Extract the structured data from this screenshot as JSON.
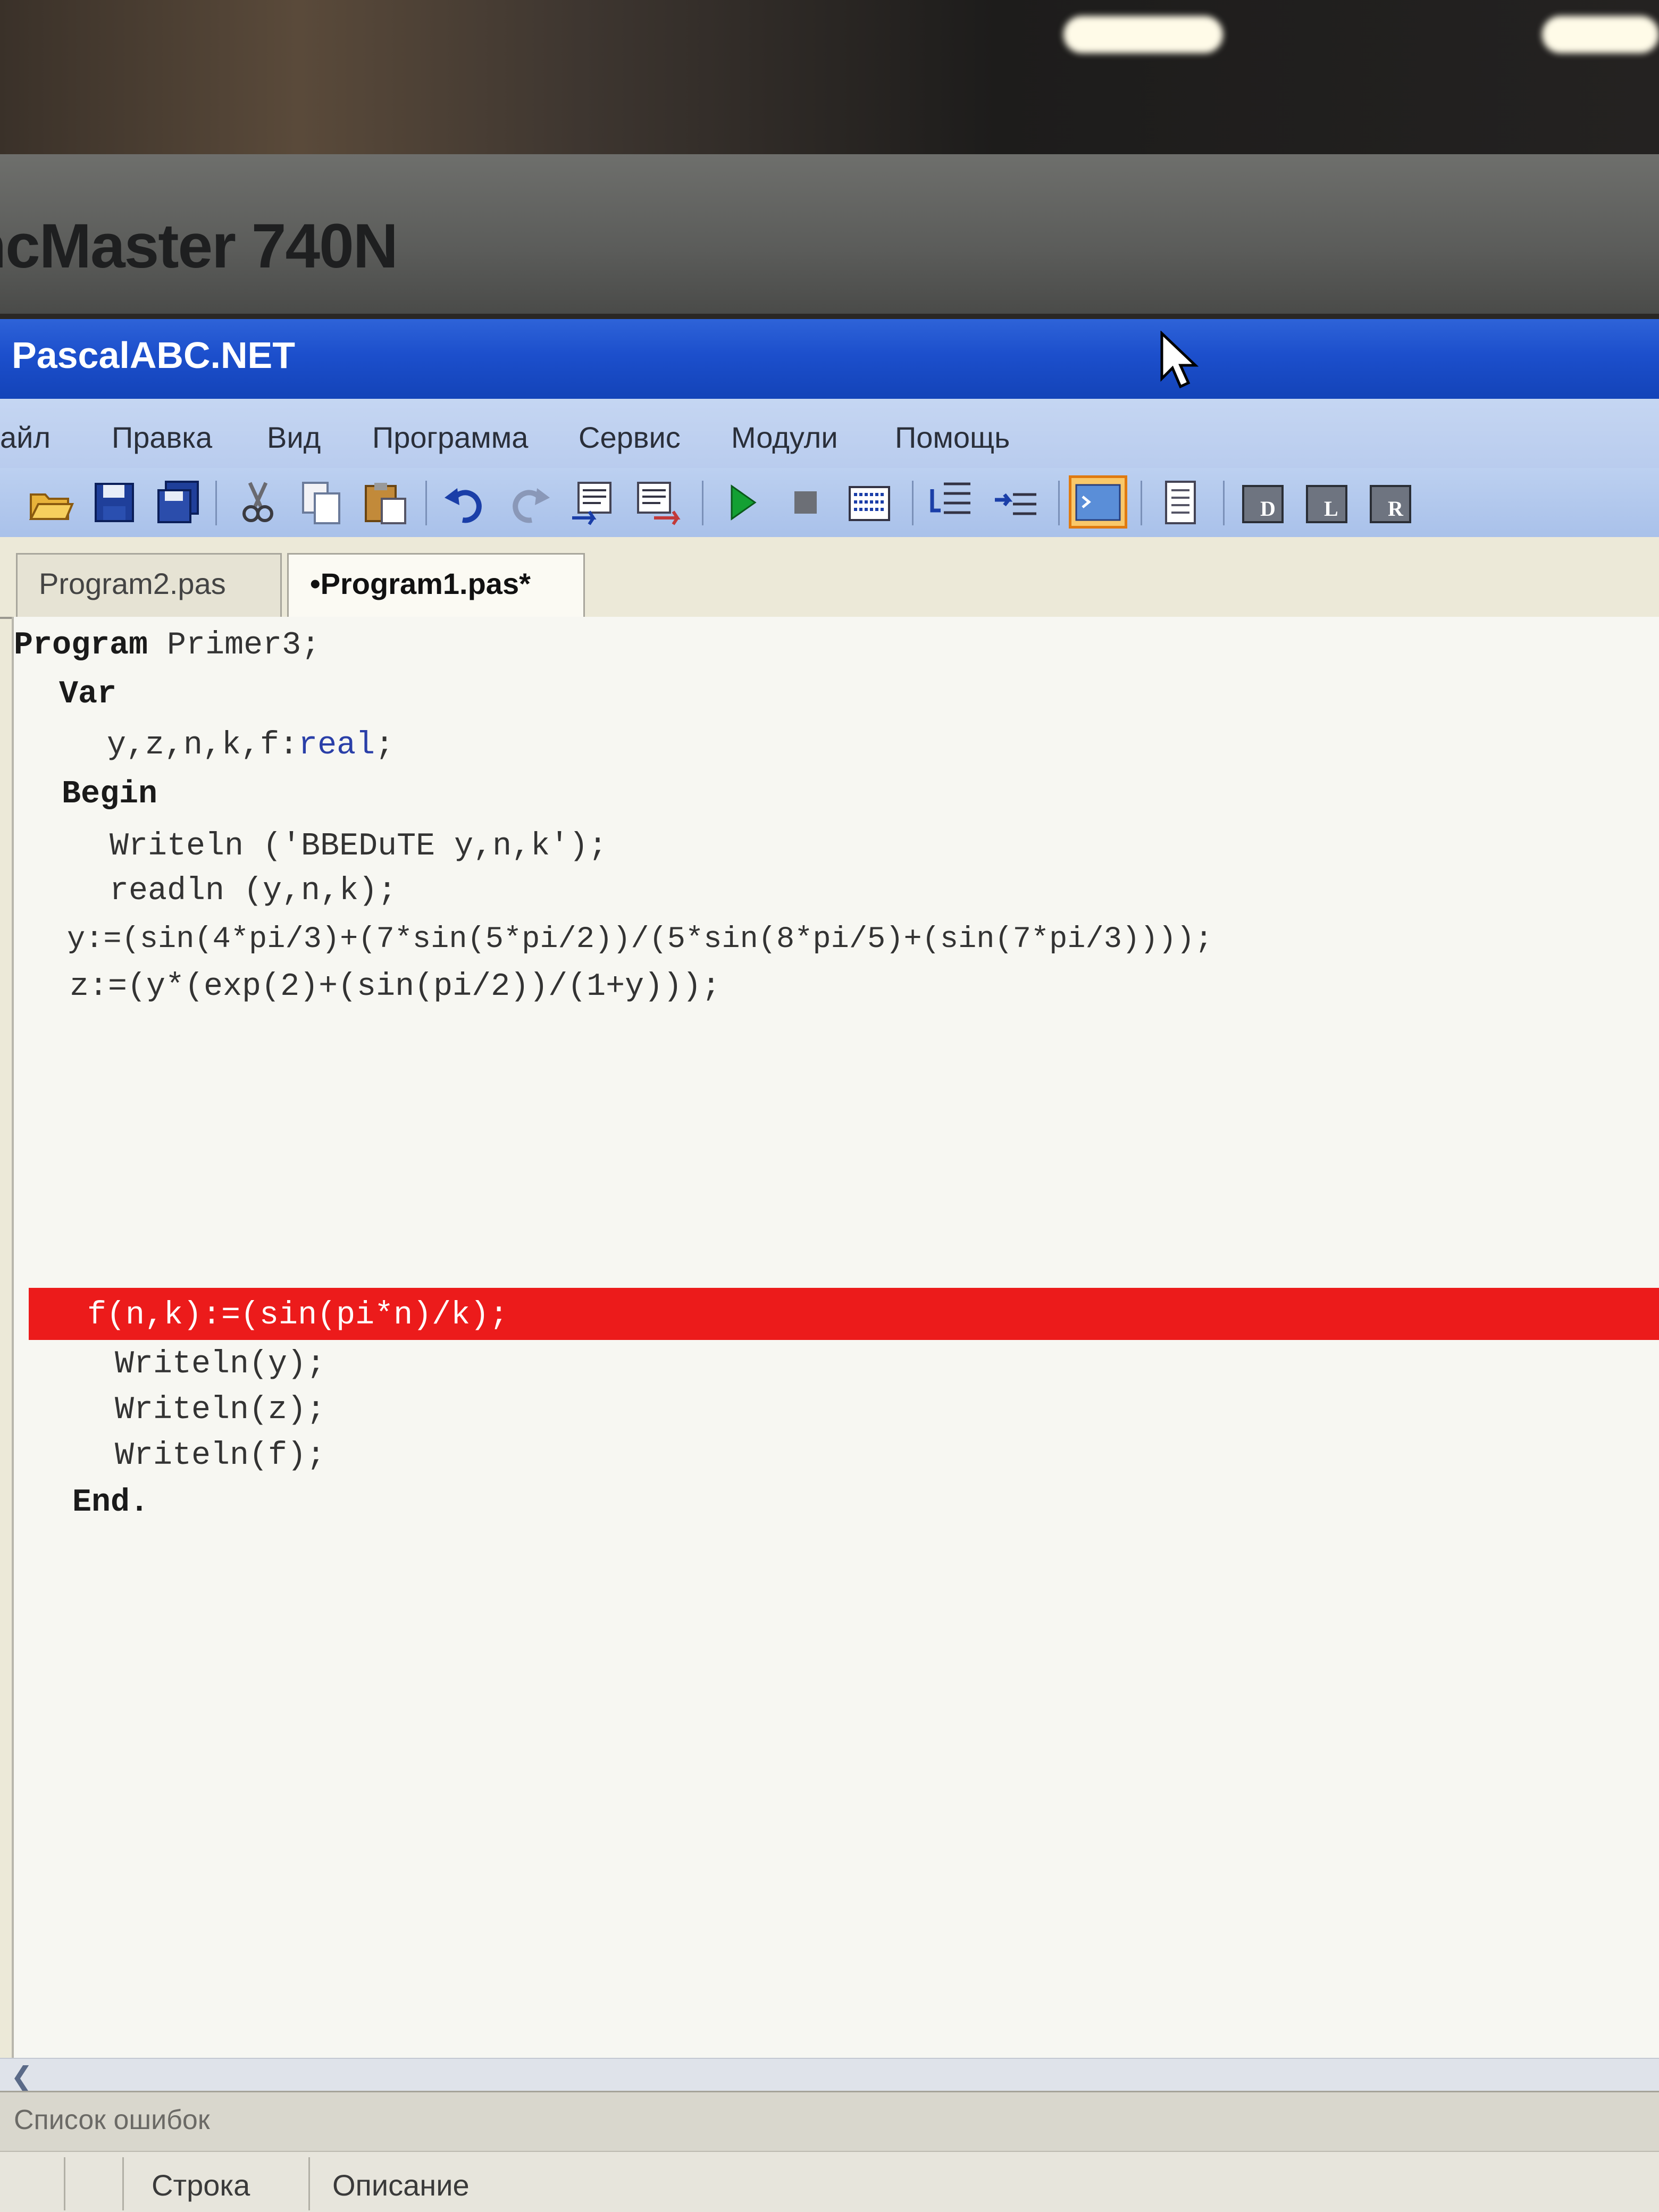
{
  "monitor": {
    "brand_text": "ncMaster 740N"
  },
  "window": {
    "title": "PascalABC.NET"
  },
  "menu": {
    "items": [
      "айл",
      "Правка",
      "Вид",
      "Программа",
      "Сервис",
      "Модули",
      "Помощь"
    ]
  },
  "toolbar": {
    "icons": [
      "open-icon",
      "save-icon",
      "save-all-icon",
      "cut-icon",
      "copy-icon",
      "paste-icon",
      "undo-icon",
      "redo-icon",
      "comment-icon",
      "uncomment-icon",
      "run-icon",
      "stop-icon",
      "debug-icon",
      "step-into-icon",
      "step-over-icon",
      "output-window-icon",
      "properties-icon",
      "form-d-icon",
      "form-l-icon",
      "form-r-icon"
    ]
  },
  "tabs": [
    {
      "label": "Program2.pas",
      "active": false
    },
    {
      "label": "•Program1.pas*",
      "active": true
    }
  ],
  "editor": {
    "lines": [
      {
        "kw": "Program",
        "text": " Primer3;"
      },
      {
        "kw": "Var",
        "text": ""
      },
      {
        "kw": "",
        "text": "y,z,n,k,f:",
        "type": "real",
        "tail": ";"
      },
      {
        "kw": "Begin",
        "text": ""
      },
      {
        "kw": "",
        "text": "Writeln ('BBEDuTE y,n,k');"
      },
      {
        "kw": "",
        "text": "readln (y,n,k);"
      },
      {
        "kw": "",
        "text": "y:=(sin(4*pi/3)+(7*sin(5*pi/2))/(5*sin(8*pi/5)+(sin(7*pi/3))));"
      },
      {
        "kw": "",
        "text": "z:=(y*(exp(2)+(sin(pi/2))/(1+y)));"
      },
      {
        "kw": "",
        "text": "f(n,k):=(sin(pi*n)/k);"
      },
      {
        "kw": "",
        "text": "Writeln(y);"
      },
      {
        "kw": "",
        "text": "Writeln(z);"
      },
      {
        "kw": "",
        "text": "Writeln(f);"
      },
      {
        "kw": "End.",
        "text": ""
      }
    ],
    "error_line_index": 8,
    "error_color": "#ec1b1b"
  },
  "error_panel": {
    "title": "Список ошибок",
    "columns": [
      "Строка",
      "Описание"
    ]
  },
  "colors": {
    "titlebar": "#1c4fcc",
    "menubar": "#c5d6f2",
    "editor_bg": "#f7f7f2"
  }
}
